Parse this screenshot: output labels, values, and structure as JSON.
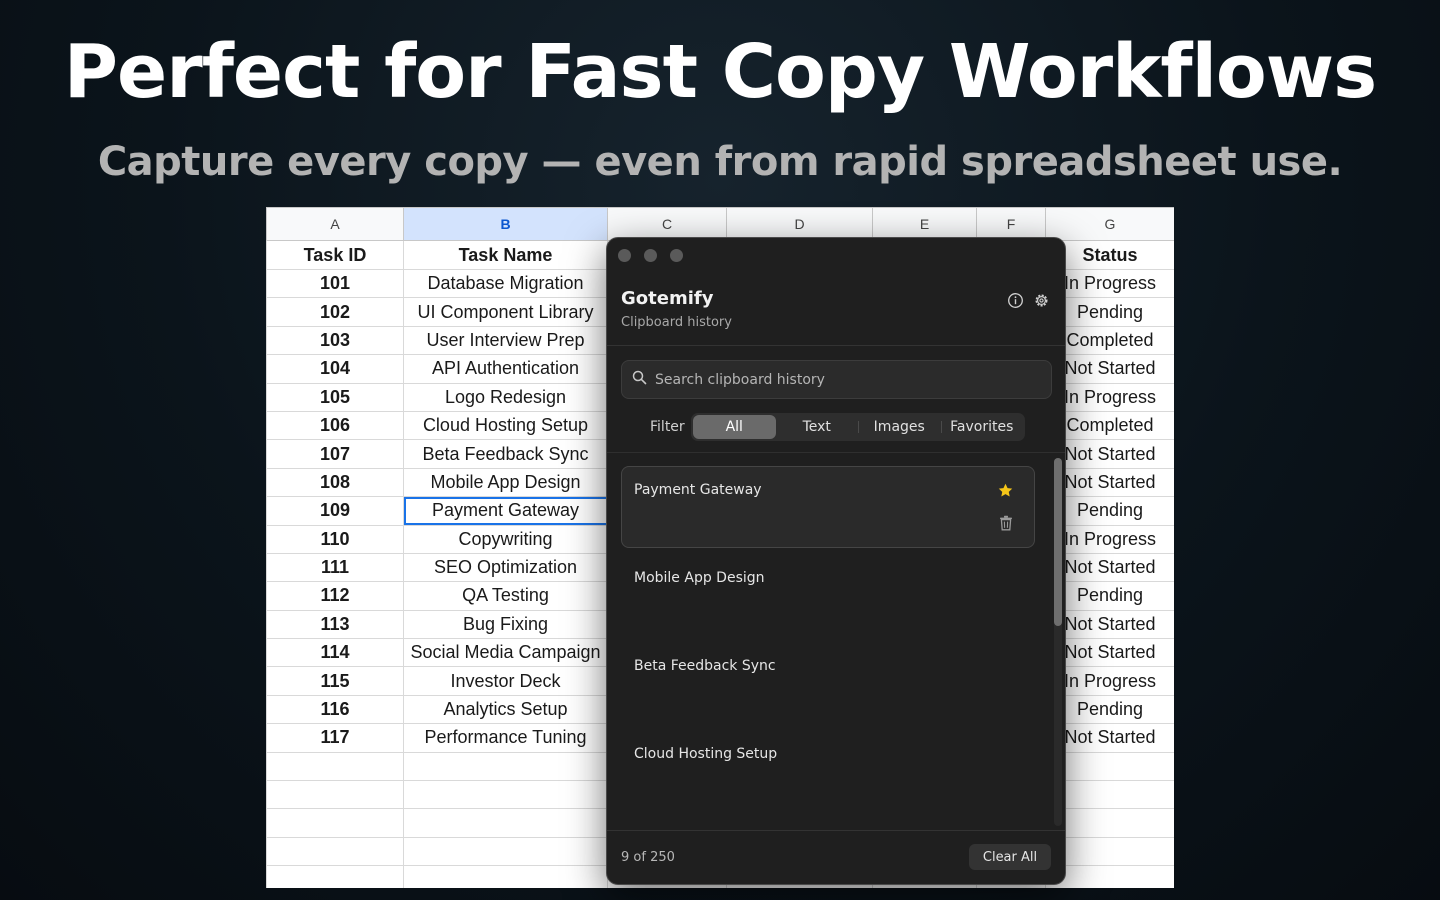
{
  "headline": "Perfect for Fast Copy Workflows",
  "subheadline": "Capture every copy — even from rapid spreadsheet use.",
  "sheet": {
    "column_letters": [
      "A",
      "B",
      "C",
      "D",
      "E",
      "F",
      "G"
    ],
    "active_column": "B",
    "headers": {
      "task_id": "Task ID",
      "task_name": "Task Name",
      "status": "Status"
    },
    "rows": [
      {
        "id": "101",
        "name": "Database Migration",
        "status": "In Progress"
      },
      {
        "id": "102",
        "name": "UI Component Library",
        "status": "Pending"
      },
      {
        "id": "103",
        "name": "User Interview Prep",
        "status": "Completed"
      },
      {
        "id": "104",
        "name": "API Authentication",
        "status": "Not Started"
      },
      {
        "id": "105",
        "name": "Logo Redesign",
        "status": "In Progress"
      },
      {
        "id": "106",
        "name": "Cloud Hosting Setup",
        "status": "Completed"
      },
      {
        "id": "107",
        "name": "Beta Feedback Sync",
        "status": "Not Started"
      },
      {
        "id": "108",
        "name": "Mobile App Design",
        "status": "Not Started"
      },
      {
        "id": "109",
        "name": "Payment Gateway",
        "status": "Pending"
      },
      {
        "id": "110",
        "name": "Copywriting",
        "status": "In Progress"
      },
      {
        "id": "111",
        "name": "SEO Optimization",
        "status": "Not Started"
      },
      {
        "id": "112",
        "name": "QA Testing",
        "status": "Pending"
      },
      {
        "id": "113",
        "name": "Bug Fixing",
        "status": "Not Started"
      },
      {
        "id": "114",
        "name": "Social Media Campaign",
        "status": "Not Started"
      },
      {
        "id": "115",
        "name": "Investor Deck",
        "status": "In Progress"
      },
      {
        "id": "116",
        "name": "Analytics Setup",
        "status": "Pending"
      },
      {
        "id": "117",
        "name": "Performance Tuning",
        "status": "Not Started"
      }
    ],
    "selected_cell": "B109"
  },
  "popup": {
    "title": "Gotemify",
    "subtitle": "Clipboard history",
    "icons": [
      "info-icon",
      "gear-icon",
      "search-icon",
      "star-icon",
      "trash-icon"
    ],
    "search_placeholder": "Search clipboard history",
    "filter_label": "Filter",
    "filters": [
      "All",
      "Text",
      "Images",
      "Favorites"
    ],
    "active_filter": "All",
    "items": [
      {
        "text": "Payment Gateway",
        "favorite": true
      },
      {
        "text": "Mobile App Design",
        "favorite": false
      },
      {
        "text": "Beta Feedback Sync",
        "favorite": false
      },
      {
        "text": "Cloud Hosting Setup",
        "favorite": false
      }
    ],
    "count_text": "9 of 250",
    "clear_label": "Clear All"
  },
  "colors": {
    "star": "#f5c518",
    "selection": "#1a73e8",
    "active_column_bg": "#d3e3fd"
  }
}
